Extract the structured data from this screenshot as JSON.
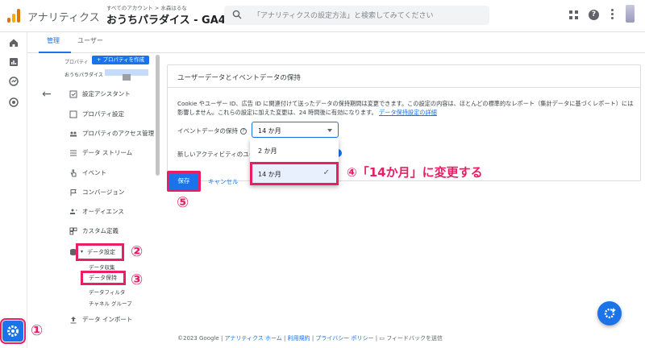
{
  "header": {
    "app_name": "アナリティクス",
    "account_breadcrumb": "すべてのアカウント > 水森はるな",
    "property_title": "おうちパラダイス - GA4",
    "search_placeholder": "「アナリティクスの設定方法」と検索してみてください"
  },
  "tabs": [
    "管理",
    "ユーザー"
  ],
  "nav": {
    "property_label": "プロパティ",
    "create_property": "+ プロパティを作成",
    "property_name": "おうちパラダイス -",
    "items": [
      {
        "label": "設定アシスタント",
        "icon": "checkbox-icon"
      },
      {
        "label": "プロパティ設定",
        "icon": "square-icon"
      },
      {
        "label": "プロパティのアクセス管理",
        "icon": "people-icon"
      },
      {
        "label": "データ ストリーム",
        "icon": "stream-icon"
      },
      {
        "label": "イベント",
        "icon": "touch-icon"
      },
      {
        "label": "コンバージョン",
        "icon": "flag-icon"
      },
      {
        "label": "オーディエンス",
        "icon": "audience-icon"
      },
      {
        "label": "カスタム定義",
        "icon": "custom-icon"
      },
      {
        "label": "データ設定",
        "icon": "database-icon"
      },
      {
        "label": "データ インポート",
        "icon": "upload-icon"
      }
    ],
    "sub_items": [
      "データ収集",
      "データ保持",
      "データフィルタ",
      "チャネル グループ"
    ]
  },
  "panel": {
    "title": "ユーザーデータとイベントデータの保持",
    "description": "Cookie やユーザー ID、広告 ID に関連付けて送ったデータの保持期間は変更できます。この設定の内容は、ほとんどの標準的なレポート（集計データに基づくレポート）には影響しません。これらの設定に加えた変更は、24 時間後に有効になります。",
    "description_link": "データ保持設定の詳細",
    "event_retention_label": "イベントデータの保持",
    "event_retention_value": "14 か月",
    "new_activity_label": "新しいアクティビティのユー",
    "save": "保存",
    "cancel": "キャンセル"
  },
  "dropdown": {
    "options": [
      "2 か月",
      "14 か月"
    ],
    "selected": "14 か月"
  },
  "annotations": {
    "n1": "①",
    "n2": "②",
    "n3": "③",
    "n4": "④「14か月」に変更する",
    "n5": "⑤"
  },
  "footer": {
    "copyright": "©2023 Google",
    "links": [
      "アナリティクス ホーム",
      "利用規約",
      "プライバシー ポリシー"
    ],
    "feedback": "フィードバックを送信"
  },
  "colors": {
    "accent": "#1a73e8",
    "annotation": "#e91e63"
  }
}
